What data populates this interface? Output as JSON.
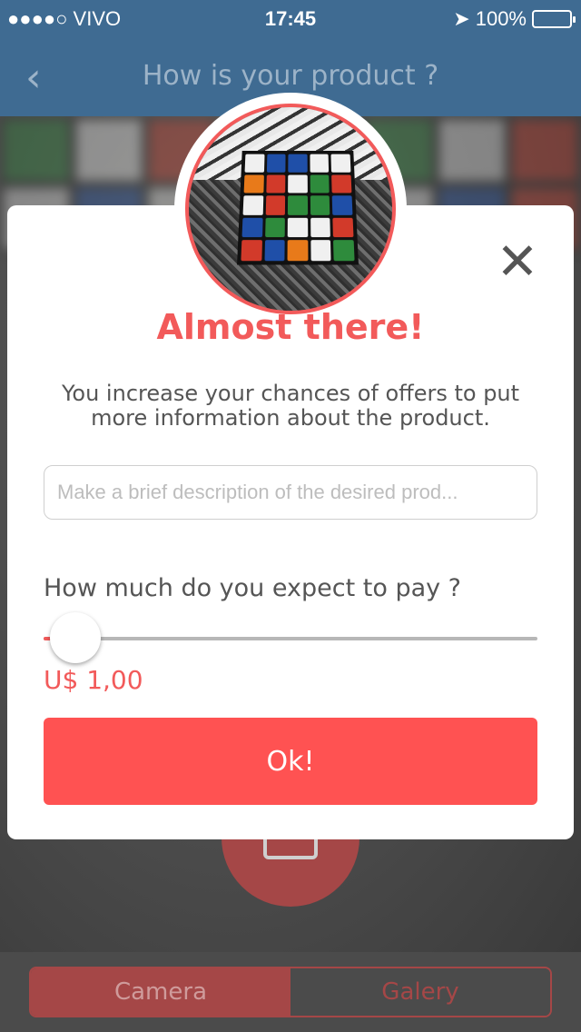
{
  "status_bar": {
    "carrier": "●●●●○ VIVO",
    "time": "17:45",
    "battery": "100%",
    "icons": [
      "wifi-icon",
      "location-arrow-icon",
      "battery-icon"
    ]
  },
  "nav": {
    "back_icon": "chevron-left-icon",
    "back_glyph": "‹",
    "title": "How is your product ?"
  },
  "modal": {
    "close_glyph": "✕",
    "headline": "Almost there!",
    "subtext": "You increase your chances of offers to put more information about the product.",
    "description_placeholder": "Make a brief description of the desired prod...",
    "description_value": "",
    "price_question": "How much do you expect to pay ?",
    "slider_level": 0.01,
    "price_value": "U$ 1,00",
    "ok_label": "Ok!"
  },
  "bottom_tabs": {
    "camera": "Camera",
    "gallery": "Galery",
    "selected": "camera"
  },
  "colors": {
    "accent": "#ff5252",
    "nav_blue": "#3f6b92",
    "text_gray": "#555555"
  }
}
